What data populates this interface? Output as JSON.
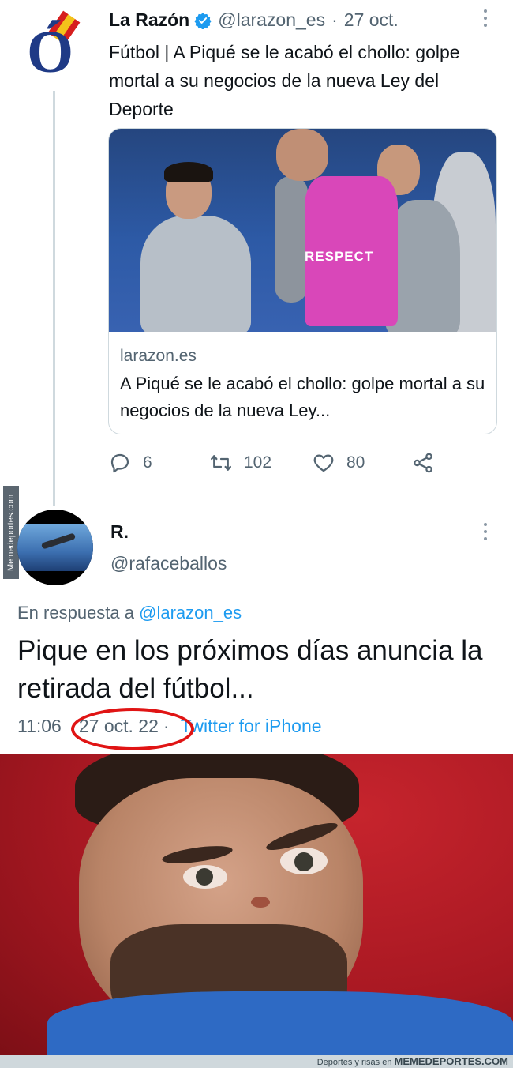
{
  "tweet1": {
    "name": "La Razón",
    "handle": "@larazon_es",
    "separator": "·",
    "date": "27 oct.",
    "text": "Fútbol | A Piqué se le acabó el chollo: golpe mortal a su negocios de la nueva Ley del Deporte",
    "card": {
      "domain": "larazon.es",
      "title": "A Piqué se le acabó el chollo: golpe mortal a su negocios de la nueva Ley...",
      "photo_text": "RESPECT"
    },
    "actions": {
      "reply_count": "6",
      "retweet_count": "102",
      "like_count": "80"
    }
  },
  "tweet2": {
    "name": "R.",
    "handle": "@rafaceballos",
    "reply_prefix": "En respuesta a",
    "reply_mention": "@larazon_es",
    "text": "Pique en los próximos días anuncia la retirada del fútbol...",
    "time": "11:06",
    "date": "27 oct. 22",
    "dot": "·",
    "source": "Twitter for iPhone"
  },
  "watermark": {
    "side": "Memedeportes.com",
    "footer_prefix": "Deportes y risas en",
    "footer_brand": "MEMEDEPORTES.COM"
  },
  "colors": {
    "link": "#1d9bf0",
    "muted": "#536471",
    "highlight_circle": "#e01414",
    "verified": "#1d9bf0"
  }
}
